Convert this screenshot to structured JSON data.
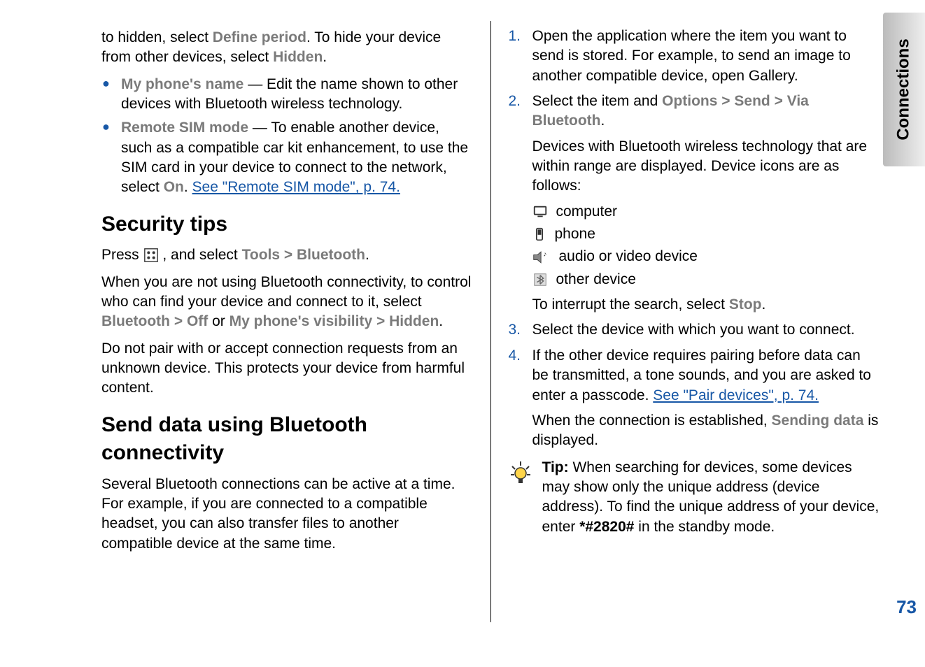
{
  "side_tab": "Connections",
  "page_number": "73",
  "left": {
    "intro_bullets": [
      {
        "pre": "to hidden, select ",
        "bold1": "Define period",
        "mid1": ". To hide your device from other devices, select ",
        "bold2": "Hidden",
        "tail": "."
      }
    ],
    "bullets": [
      {
        "label": "My phone's name",
        "dash_text": " — Edit the name shown to other devices with Bluetooth wireless technology."
      },
      {
        "label": "Remote SIM mode",
        "dash_text": " — To enable another device, such as a compatible car kit enhancement, to use the SIM card in your device to connect to the network, select ",
        "bold_in": "On",
        "after_bold": ". ",
        "link": "See \"Remote SIM mode\", p. 74."
      }
    ],
    "heading1": "Security tips",
    "press_line": {
      "pre": "Press ",
      "mid": ", and select ",
      "path1": "Tools",
      "chev": ">",
      "path2": "Bluetooth",
      "tail": "."
    },
    "para2": {
      "t1": "When you are not using Bluetooth connectivity, to control who can find your device and connect to it, select ",
      "b1": "Bluetooth",
      "c1": ">",
      "b2": "Off",
      "or": " or ",
      "b3": "My phone's visibility",
      "c2": ">",
      "b4": "Hidden",
      "tail": "."
    },
    "para3": "Do not pair with or accept connection requests from an unknown device. This protects your device from harmful content.",
    "heading2": "Send data using Bluetooth connectivity",
    "para4": "Several Bluetooth connections can be active at a time. For example, if you are connected to a compatible headset, you can also transfer files to another compatible device at the same time."
  },
  "right": {
    "steps": [
      {
        "n": "1.",
        "text": "Open the application where the item you want to send is stored. For example, to send an image to another compatible device, open Gallery."
      },
      {
        "n": "2.",
        "pre": "Select the item and ",
        "b1": "Options",
        "c1": ">",
        "b2": "Send",
        "c2": ">",
        "b3": "Via Bluetooth",
        "tail": ".",
        "sub1": "Devices with Bluetooth wireless technology that are within range are displayed. Device icons are as follows:",
        "icons": [
          {
            "name": "computer-icon",
            "label": "computer"
          },
          {
            "name": "phone-icon",
            "label": "phone"
          },
          {
            "name": "audio-video-icon",
            "label": "audio or video device"
          },
          {
            "name": "other-device-icon",
            "label": "other device"
          }
        ],
        "sub2_pre": "To interrupt the search, select ",
        "sub2_bold": "Stop",
        "sub2_tail": "."
      },
      {
        "n": "3.",
        "text": "Select the device with which you want to connect."
      },
      {
        "n": "4.",
        "pre": "If the other device requires pairing before data can be transmitted, a tone sounds, and you are asked to enter a passcode. ",
        "link": "See \"Pair devices\", p. 74.",
        "sub_pre": "When the connection is established, ",
        "sub_bold": "Sending data",
        "sub_tail": " is displayed."
      }
    ],
    "tip": {
      "label": "Tip:",
      "pre": " When searching for devices, some devices may show only the unique address (device address). To find the unique address of your device, enter ",
      "code": "*#2820#",
      "tail": " in the standby mode."
    }
  }
}
